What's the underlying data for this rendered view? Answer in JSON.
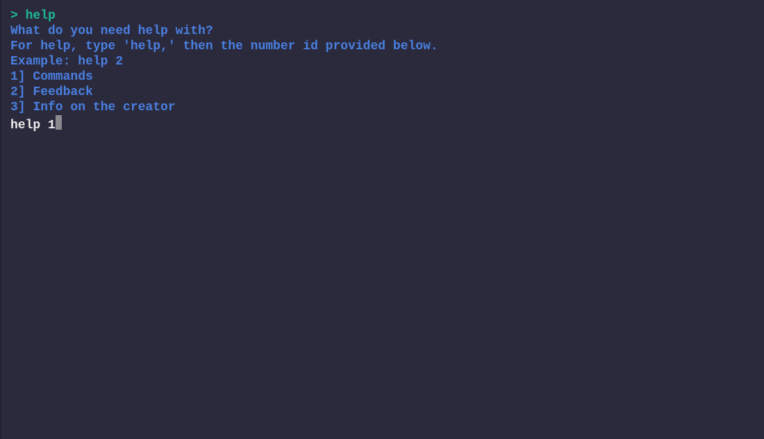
{
  "terminal": {
    "command_line": "> help",
    "output": [
      "What do you need help with?",
      "For help, type 'help,' then the number id provided below.",
      "Example: help 2",
      "1] Commands",
      "2] Feedback",
      "3] Info on the creator"
    ],
    "current_input": "help 1"
  },
  "colors": {
    "background": "#2b2a3d",
    "prompt": "#1db992",
    "output": "#4a7fe0",
    "input": "#ececec",
    "cursor": "#8a8a8e"
  }
}
